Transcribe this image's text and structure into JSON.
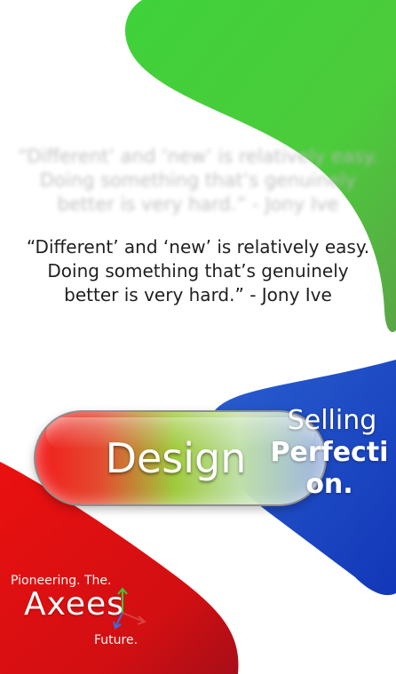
{
  "quote": {
    "lines": [
      "“Different’ and ‘new’ is relatively easy.",
      "Doing something that’s genuinely",
      "better is very hard.” - Jony Ive"
    ]
  },
  "pill": {
    "label": "Design"
  },
  "tagline": {
    "line1": "Selling",
    "line2": "Perfecti",
    "line3": "on."
  },
  "logo": {
    "top_text": "Pioneering. The.",
    "word": "Axees",
    "bottom_text": "Future."
  },
  "colors": {
    "green": "#4fd13a",
    "blue": "#1f47c8",
    "red": "#d40f10",
    "text": "#1f1f1f"
  },
  "icons": [
    "axes-icon"
  ]
}
